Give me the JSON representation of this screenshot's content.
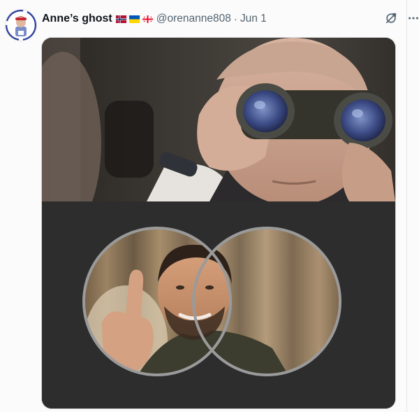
{
  "tweet": {
    "author_name": "Anne’s ghost",
    "handle": "@orenanne808",
    "separator": "·",
    "date": "Jun 1",
    "flags": [
      "norway-flag",
      "ukraine-flag",
      "georgia-flag"
    ],
    "icons": {
      "grok": "grok-icon",
      "more": "more-icon"
    },
    "media": {
      "top_panel": "man-with-binoculars-image",
      "bottom_panel": "binocular-view-image"
    }
  },
  "colors": {
    "text_primary": "#0f1419",
    "text_secondary": "#536471",
    "media_background": "#2d2d2d"
  }
}
